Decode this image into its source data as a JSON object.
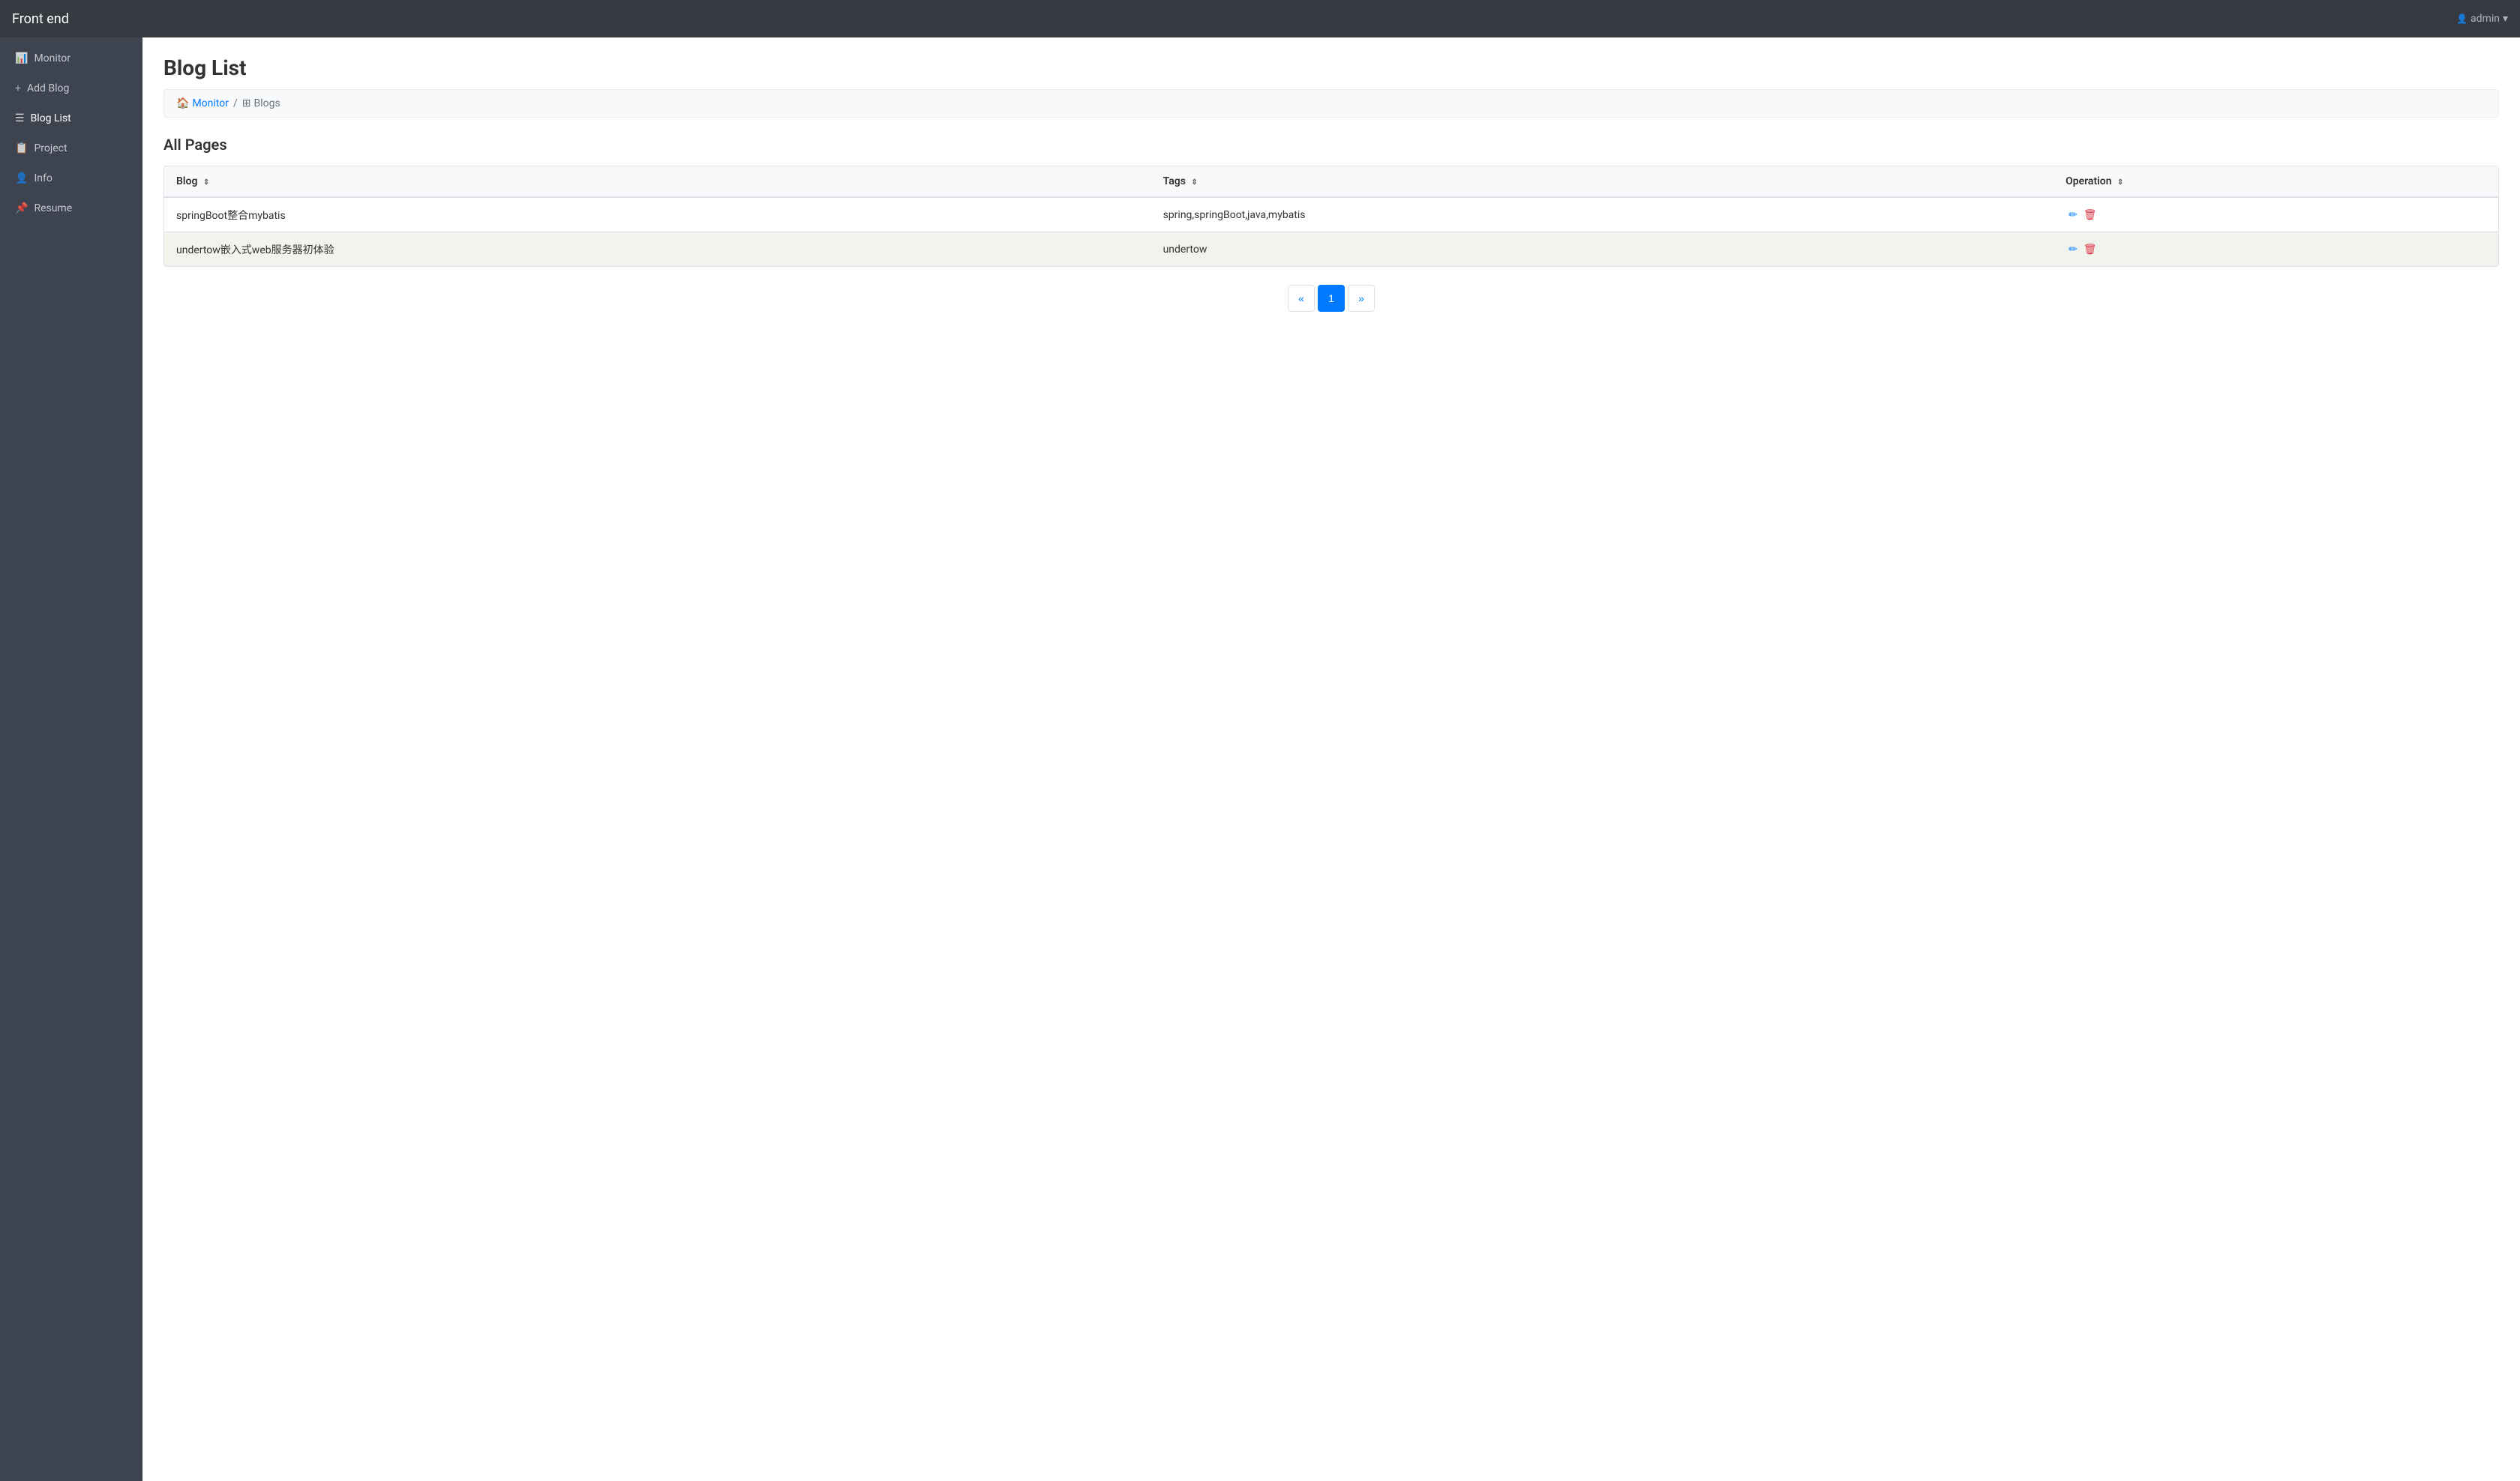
{
  "navbar": {
    "brand": "Front end",
    "user": "admin",
    "dropdown_icon": "▾"
  },
  "sidebar": {
    "items": [
      {
        "id": "monitor",
        "label": "Monitor",
        "icon": "📊"
      },
      {
        "id": "add-blog",
        "label": "+ Add Blog",
        "icon": ""
      },
      {
        "id": "blog-list",
        "label": "Blog List",
        "icon": "☰"
      },
      {
        "id": "project",
        "label": "Project",
        "icon": "📋"
      },
      {
        "id": "info",
        "label": "Info",
        "icon": "👤"
      },
      {
        "id": "resume",
        "label": "Resume",
        "icon": "📌"
      }
    ]
  },
  "main": {
    "page_title": "Blog List",
    "breadcrumb": {
      "home_label": "Monitor",
      "home_icon": "🏠",
      "separator": "/",
      "current_icon": "⊞",
      "current_label": "Blogs"
    },
    "section_title": "All Pages",
    "table": {
      "columns": [
        {
          "key": "blog",
          "label": "Blog",
          "sortable": true
        },
        {
          "key": "tags",
          "label": "Tags",
          "sortable": true
        },
        {
          "key": "operation",
          "label": "Operation",
          "sortable": true
        }
      ],
      "rows": [
        {
          "id": 1,
          "blog": "springBoot整合mybatis",
          "tags": "spring,springBoot,java,mybatis"
        },
        {
          "id": 2,
          "blog": "undertow嵌入式web服务器初体验",
          "tags": "undertow"
        }
      ]
    },
    "pagination": {
      "prev": "«",
      "next": "»",
      "pages": [
        1
      ],
      "current_page": 1
    },
    "actions": {
      "edit_icon": "✏",
      "delete_icon": "🗑"
    }
  }
}
